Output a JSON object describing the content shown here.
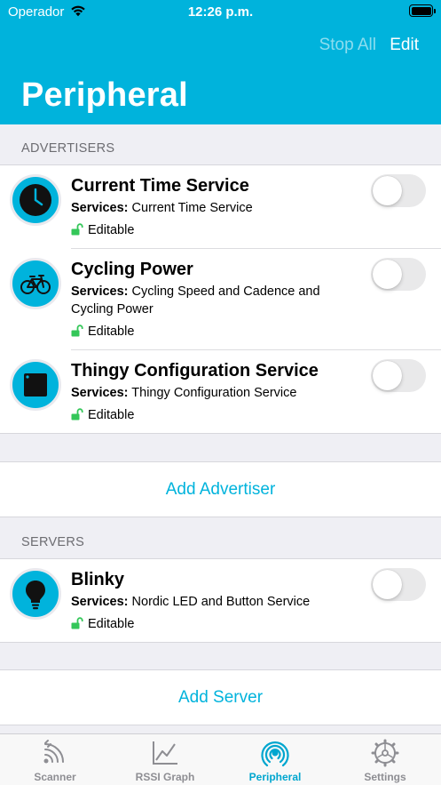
{
  "status_bar": {
    "carrier": "Operador",
    "time": "12:26 p.m."
  },
  "nav": {
    "stop_all": "Stop All",
    "edit": "Edit",
    "title": "Peripheral"
  },
  "advertisers": {
    "header": "ADVERTISERS",
    "items": [
      {
        "title": "Current Time Service",
        "services_label": "Services:",
        "services": "Current Time Service",
        "editable": "Editable",
        "enabled": false,
        "icon": "clock-icon"
      },
      {
        "title": "Cycling Power",
        "services_label": "Services:",
        "services": "Cycling Speed and Cadence and Cycling Power",
        "editable": "Editable",
        "enabled": false,
        "icon": "bicycle-icon"
      },
      {
        "title": "Thingy Configuration Service",
        "services_label": "Services:",
        "services": "Thingy Configuration Service",
        "editable": "Editable",
        "enabled": false,
        "icon": "thingy-icon"
      }
    ],
    "add_label": "Add Advertiser"
  },
  "servers": {
    "header": "SERVERS",
    "items": [
      {
        "title": "Blinky",
        "services_label": "Services:",
        "services": "Nordic LED and Button Service",
        "editable": "Editable",
        "enabled": false,
        "icon": "lightbulb-icon"
      }
    ],
    "add_label": "Add Server"
  },
  "tabs": [
    {
      "label": "Scanner",
      "icon": "scanner-icon",
      "active": false
    },
    {
      "label": "RSSI Graph",
      "icon": "graph-icon",
      "active": false
    },
    {
      "label": "Peripheral",
      "icon": "broadcast-icon",
      "active": true
    },
    {
      "label": "Settings",
      "icon": "gear-icon",
      "active": false
    }
  ],
  "colors": {
    "accent": "#00b3dc",
    "editable_green": "#34c759",
    "toggle_off": "#e9e9ea",
    "inactive_tab": "#8e8e93"
  }
}
